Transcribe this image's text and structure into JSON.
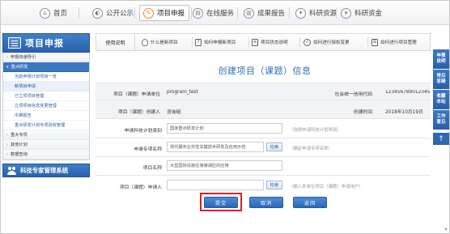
{
  "topnav": {
    "items": [
      {
        "label": "首页",
        "icon": "home-icon",
        "glyph": "⌂",
        "active": false
      },
      {
        "label": "公开公示",
        "icon": "megaphone-icon",
        "glyph": "◐",
        "active": false
      },
      {
        "label": "项目申报",
        "icon": "pencil-icon",
        "glyph": "✎",
        "active": true
      },
      {
        "label": "在线服务",
        "icon": "service-icon",
        "glyph": "▤",
        "active": false
      },
      {
        "label": "成果报告",
        "icon": "report-icon",
        "glyph": "▥",
        "active": false
      },
      {
        "label": "科研资源",
        "icon": "resource-icon",
        "glyph": "✦",
        "active": false
      },
      {
        "label": "科研资金",
        "icon": "money-icon",
        "glyph": "¥",
        "active": false
      }
    ]
  },
  "sidebar": {
    "title": "项目申报",
    "rows": [
      {
        "label": "申报快速导引",
        "type": "group"
      },
      {
        "label": "重点研发",
        "type": "group-open"
      },
      {
        "label": "当前申报计划项目一览",
        "type": "sub"
      },
      {
        "label": "新项目申请",
        "type": "sub",
        "selected": true
      },
      {
        "label": "已立项项目管理",
        "type": "sub"
      },
      {
        "label": "立项项目信息变更管理",
        "type": "sub"
      },
      {
        "label": "中期报告",
        "type": "sub"
      },
      {
        "label": "重点研发计划专项验收管理",
        "type": "sub"
      },
      {
        "label": "重大专项",
        "type": "group"
      },
      {
        "label": "其他计划",
        "type": "group"
      },
      {
        "label": "数据查询",
        "type": "group"
      }
    ],
    "footer": "科技专家管理系统"
  },
  "toolbar": {
    "intro": "使用说明",
    "items": [
      {
        "label": "什么是新项目",
        "icon": "bulb-icon",
        "glyph": "·"
      },
      {
        "label": "如何申报新项目",
        "icon": "question-icon",
        "glyph": "?"
      },
      {
        "label": "项目状态说明",
        "icon": "document-icon",
        "glyph": "≡"
      },
      {
        "label": "如何进行授权变更",
        "icon": "check-icon",
        "glyph": "✓"
      },
      {
        "label": "如何进行项目管理",
        "icon": "list-icon",
        "glyph": "☰"
      }
    ]
  },
  "form": {
    "title": "创建项目（课题）信息",
    "unit_label": "项目（课题）申请单位",
    "unit_value": "program_test",
    "credit_label": "社会统一信用代码",
    "credit_value": "123456789012345",
    "creator_label": "项目（课题）创建人",
    "creator_value": "咨询组",
    "created_label": "创建时间",
    "created_value": "2018年10月19日",
    "plan_category_label": "申请科技计划类别",
    "plan_category_value": "国家重点研发计划",
    "plan_category_hint": "（选择申请科技计划类别）",
    "program_label": "申请专项名称",
    "program_value": "现代服务业共性关键技术研发及应用示范",
    "program_search": "检索",
    "program_hint": "（确定申请专项名称）",
    "project_name_label": "项目名称",
    "project_name_value": "大型国际设施在港港湖应的应用",
    "applicant_label": "项目（课题）申请人",
    "applicant_value": "",
    "applicant_search": "检索",
    "applicant_hint": "（输入本单位项目（课题）申请用户）"
  },
  "actions": {
    "submit": "提交",
    "cancel": "取消",
    "back": "返回",
    "highlight_color": "#e02020"
  },
  "floating": {
    "items": [
      "申报说明",
      "常见答疑",
      "收藏本站",
      "工作意见"
    ],
    "up": "↑"
  },
  "colors": {
    "brand_blue": "#2e6fb8",
    "nav_active_accent": "#e2872b"
  }
}
